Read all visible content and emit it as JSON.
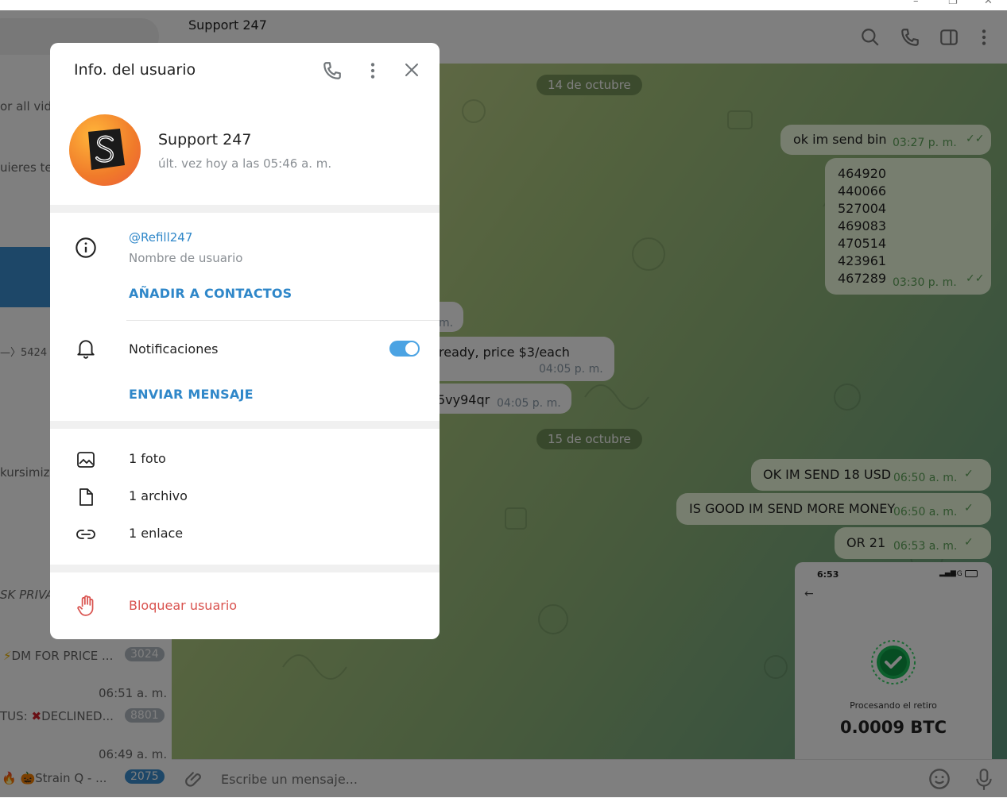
{
  "window": {
    "min": "–",
    "max": "❐",
    "close": "✕"
  },
  "sidebar": {
    "snippet_1": "or all vide",
    "snippet_2": "uieres te",
    "snippet_3": "—〉5424",
    "snippet_4": "kursimizc",
    "snippet_5": "SK PRIVA",
    "chat_a": {
      "prefix": "⚡",
      "text": "DM FOR PRICE ...",
      "badge": "3024"
    },
    "chat_b": {
      "time": "06:51 a. m.",
      "prefix": "TUS: ",
      "mark": "✖",
      "text": "DECLINED...",
      "badge": "8801"
    },
    "chat_c": {
      "time": "06:49 a. m.",
      "prefix": "🔥 🎃",
      "text": "Strain  Q - ...",
      "badge": "2075"
    }
  },
  "header": {
    "title": "Support 247",
    "subtitle": ""
  },
  "chat": {
    "date_1": "14 de octubre",
    "date_2": "15 de octubre",
    "messages_out_1": {
      "text": "ok im send bin",
      "time": "03:27 p. m."
    },
    "bins": [
      "464920",
      "440066",
      "527004",
      "469083",
      "470514",
      "423961",
      "467289"
    ],
    "bins_time": "03:30 p. m.",
    "in_1": "m.",
    "in_2": {
      "text": "ready, price $3/each",
      "time": "04:05 p. m."
    },
    "in_3": {
      "text": "5vy94qr",
      "time": "04:05 p. m."
    },
    "out_2": {
      "text": "OK IM SEND 18 USD",
      "time": "06:50 a. m."
    },
    "out_3": {
      "text": "IS GOOD IM SEND MORE MONEY",
      "time": "06:50 a. m."
    },
    "out_4": {
      "text": "OR 21",
      "time": "06:53 a. m."
    },
    "phone": {
      "clock": "6:53",
      "signal": "4G",
      "status": "Procesando el retiro",
      "amount": "0.0009 BTC"
    }
  },
  "compose": {
    "placeholder": "Escribe un mensaje..."
  },
  "modal": {
    "title": "Info. del usuario",
    "name": "Support 247",
    "last_seen": "últ. vez hoy a las 05:46 a. m.",
    "username": "@Refill247",
    "username_label": "Nombre de usuario",
    "add_contact": "AÑADIR A CONTACTOS",
    "notifications": "Notificaciones",
    "notifications_on": true,
    "send_message": "ENVIAR MENSAJE",
    "media": [
      "1 foto",
      "1 archivo",
      "1 enlace"
    ],
    "block": "Bloquear usuario"
  },
  "colors": {
    "accent": "#2f87c9",
    "danger": "#d9534f",
    "toggle": "#4ba3e3"
  }
}
